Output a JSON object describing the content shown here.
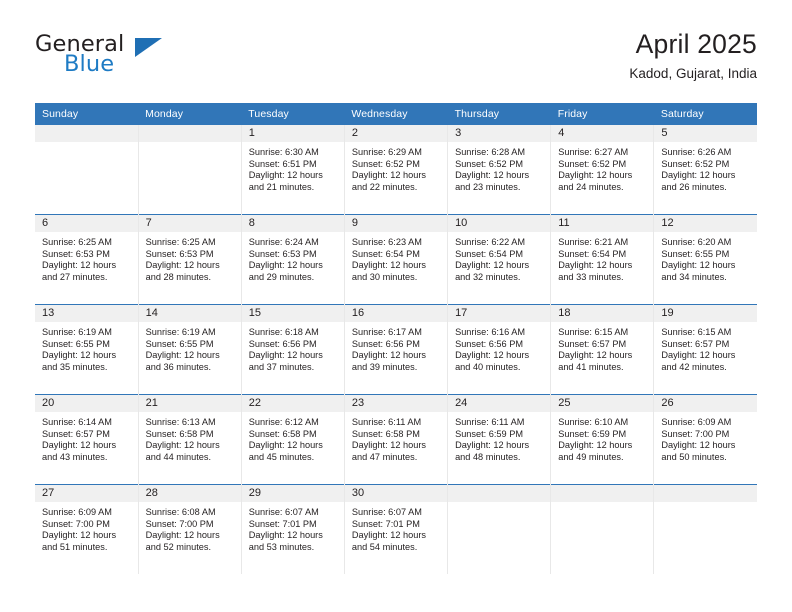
{
  "brand": {
    "name_part1": "General",
    "name_part2": "Blue",
    "logo_icon": "triangle-icon"
  },
  "header": {
    "title": "April 2025",
    "subtitle": "Kadod, Gujarat, India"
  },
  "colors": {
    "header_blue": "#3176b8",
    "brand_blue": "#1e7bc4",
    "daynum_band": "#f0f0f0",
    "text": "#231f20"
  },
  "calendar": {
    "weekday_headers": [
      "Sunday",
      "Monday",
      "Tuesday",
      "Wednesday",
      "Thursday",
      "Friday",
      "Saturday"
    ],
    "weeks": [
      [
        {
          "day": "",
          "lines": []
        },
        {
          "day": "",
          "lines": []
        },
        {
          "day": "1",
          "lines": [
            "Sunrise: 6:30 AM",
            "Sunset: 6:51 PM",
            "Daylight: 12 hours",
            "and 21 minutes."
          ]
        },
        {
          "day": "2",
          "lines": [
            "Sunrise: 6:29 AM",
            "Sunset: 6:52 PM",
            "Daylight: 12 hours",
            "and 22 minutes."
          ]
        },
        {
          "day": "3",
          "lines": [
            "Sunrise: 6:28 AM",
            "Sunset: 6:52 PM",
            "Daylight: 12 hours",
            "and 23 minutes."
          ]
        },
        {
          "day": "4",
          "lines": [
            "Sunrise: 6:27 AM",
            "Sunset: 6:52 PM",
            "Daylight: 12 hours",
            "and 24 minutes."
          ]
        },
        {
          "day": "5",
          "lines": [
            "Sunrise: 6:26 AM",
            "Sunset: 6:52 PM",
            "Daylight: 12 hours",
            "and 26 minutes."
          ]
        }
      ],
      [
        {
          "day": "6",
          "lines": [
            "Sunrise: 6:25 AM",
            "Sunset: 6:53 PM",
            "Daylight: 12 hours",
            "and 27 minutes."
          ]
        },
        {
          "day": "7",
          "lines": [
            "Sunrise: 6:25 AM",
            "Sunset: 6:53 PM",
            "Daylight: 12 hours",
            "and 28 minutes."
          ]
        },
        {
          "day": "8",
          "lines": [
            "Sunrise: 6:24 AM",
            "Sunset: 6:53 PM",
            "Daylight: 12 hours",
            "and 29 minutes."
          ]
        },
        {
          "day": "9",
          "lines": [
            "Sunrise: 6:23 AM",
            "Sunset: 6:54 PM",
            "Daylight: 12 hours",
            "and 30 minutes."
          ]
        },
        {
          "day": "10",
          "lines": [
            "Sunrise: 6:22 AM",
            "Sunset: 6:54 PM",
            "Daylight: 12 hours",
            "and 32 minutes."
          ]
        },
        {
          "day": "11",
          "lines": [
            "Sunrise: 6:21 AM",
            "Sunset: 6:54 PM",
            "Daylight: 12 hours",
            "and 33 minutes."
          ]
        },
        {
          "day": "12",
          "lines": [
            "Sunrise: 6:20 AM",
            "Sunset: 6:55 PM",
            "Daylight: 12 hours",
            "and 34 minutes."
          ]
        }
      ],
      [
        {
          "day": "13",
          "lines": [
            "Sunrise: 6:19 AM",
            "Sunset: 6:55 PM",
            "Daylight: 12 hours",
            "and 35 minutes."
          ]
        },
        {
          "day": "14",
          "lines": [
            "Sunrise: 6:19 AM",
            "Sunset: 6:55 PM",
            "Daylight: 12 hours",
            "and 36 minutes."
          ]
        },
        {
          "day": "15",
          "lines": [
            "Sunrise: 6:18 AM",
            "Sunset: 6:56 PM",
            "Daylight: 12 hours",
            "and 37 minutes."
          ]
        },
        {
          "day": "16",
          "lines": [
            "Sunrise: 6:17 AM",
            "Sunset: 6:56 PM",
            "Daylight: 12 hours",
            "and 39 minutes."
          ]
        },
        {
          "day": "17",
          "lines": [
            "Sunrise: 6:16 AM",
            "Sunset: 6:56 PM",
            "Daylight: 12 hours",
            "and 40 minutes."
          ]
        },
        {
          "day": "18",
          "lines": [
            "Sunrise: 6:15 AM",
            "Sunset: 6:57 PM",
            "Daylight: 12 hours",
            "and 41 minutes."
          ]
        },
        {
          "day": "19",
          "lines": [
            "Sunrise: 6:15 AM",
            "Sunset: 6:57 PM",
            "Daylight: 12 hours",
            "and 42 minutes."
          ]
        }
      ],
      [
        {
          "day": "20",
          "lines": [
            "Sunrise: 6:14 AM",
            "Sunset: 6:57 PM",
            "Daylight: 12 hours",
            "and 43 minutes."
          ]
        },
        {
          "day": "21",
          "lines": [
            "Sunrise: 6:13 AM",
            "Sunset: 6:58 PM",
            "Daylight: 12 hours",
            "and 44 minutes."
          ]
        },
        {
          "day": "22",
          "lines": [
            "Sunrise: 6:12 AM",
            "Sunset: 6:58 PM",
            "Daylight: 12 hours",
            "and 45 minutes."
          ]
        },
        {
          "day": "23",
          "lines": [
            "Sunrise: 6:11 AM",
            "Sunset: 6:58 PM",
            "Daylight: 12 hours",
            "and 47 minutes."
          ]
        },
        {
          "day": "24",
          "lines": [
            "Sunrise: 6:11 AM",
            "Sunset: 6:59 PM",
            "Daylight: 12 hours",
            "and 48 minutes."
          ]
        },
        {
          "day": "25",
          "lines": [
            "Sunrise: 6:10 AM",
            "Sunset: 6:59 PM",
            "Daylight: 12 hours",
            "and 49 minutes."
          ]
        },
        {
          "day": "26",
          "lines": [
            "Sunrise: 6:09 AM",
            "Sunset: 7:00 PM",
            "Daylight: 12 hours",
            "and 50 minutes."
          ]
        }
      ],
      [
        {
          "day": "27",
          "lines": [
            "Sunrise: 6:09 AM",
            "Sunset: 7:00 PM",
            "Daylight: 12 hours",
            "and 51 minutes."
          ]
        },
        {
          "day": "28",
          "lines": [
            "Sunrise: 6:08 AM",
            "Sunset: 7:00 PM",
            "Daylight: 12 hours",
            "and 52 minutes."
          ]
        },
        {
          "day": "29",
          "lines": [
            "Sunrise: 6:07 AM",
            "Sunset: 7:01 PM",
            "Daylight: 12 hours",
            "and 53 minutes."
          ]
        },
        {
          "day": "30",
          "lines": [
            "Sunrise: 6:07 AM",
            "Sunset: 7:01 PM",
            "Daylight: 12 hours",
            "and 54 minutes."
          ]
        },
        {
          "day": "",
          "lines": []
        },
        {
          "day": "",
          "lines": []
        },
        {
          "day": "",
          "lines": []
        }
      ]
    ]
  }
}
